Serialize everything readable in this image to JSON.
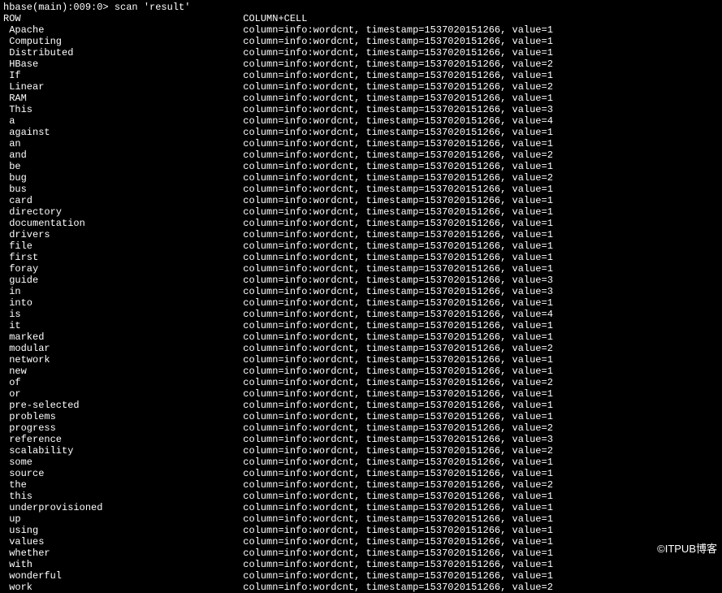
{
  "prompt": "hbase(main):009:0> scan 'result'",
  "header": {
    "row": "ROW",
    "columncell": "COLUMN+CELL"
  },
  "column_prefix": "column=info:wordcnt,",
  "timestamp_prefix": "timestamp=1537020151266,",
  "value_prefix": "value=",
  "rows": [
    {
      "key": "Apache",
      "value": 1
    },
    {
      "key": "Computing",
      "value": 1
    },
    {
      "key": "Distributed",
      "value": 1
    },
    {
      "key": "HBase",
      "value": 2
    },
    {
      "key": "If",
      "value": 1
    },
    {
      "key": "Linear",
      "value": 2
    },
    {
      "key": "RAM",
      "value": 1
    },
    {
      "key": "This",
      "value": 3
    },
    {
      "key": "a",
      "value": 4
    },
    {
      "key": "against",
      "value": 1
    },
    {
      "key": "an",
      "value": 1
    },
    {
      "key": "and",
      "value": 2
    },
    {
      "key": "be",
      "value": 1
    },
    {
      "key": "bug",
      "value": 2
    },
    {
      "key": "bus",
      "value": 1
    },
    {
      "key": "card",
      "value": 1
    },
    {
      "key": "directory",
      "value": 1
    },
    {
      "key": "documentation",
      "value": 1
    },
    {
      "key": "drivers",
      "value": 1
    },
    {
      "key": "file",
      "value": 1
    },
    {
      "key": "first",
      "value": 1
    },
    {
      "key": "foray",
      "value": 1
    },
    {
      "key": "guide",
      "value": 3
    },
    {
      "key": "in",
      "value": 3
    },
    {
      "key": "into",
      "value": 1
    },
    {
      "key": "is",
      "value": 4
    },
    {
      "key": "it",
      "value": 1
    },
    {
      "key": "marked",
      "value": 1
    },
    {
      "key": "modular",
      "value": 2
    },
    {
      "key": "network",
      "value": 1
    },
    {
      "key": "new",
      "value": 1
    },
    {
      "key": "of",
      "value": 2
    },
    {
      "key": "or",
      "value": 1
    },
    {
      "key": "pre-selected",
      "value": 1
    },
    {
      "key": "problems",
      "value": 1
    },
    {
      "key": "progress",
      "value": 2
    },
    {
      "key": "reference",
      "value": 3
    },
    {
      "key": "scalability",
      "value": 2
    },
    {
      "key": "some",
      "value": 1
    },
    {
      "key": "source",
      "value": 1
    },
    {
      "key": "the",
      "value": 2
    },
    {
      "key": "this",
      "value": 1
    },
    {
      "key": "underprovisioned",
      "value": 1
    },
    {
      "key": "up",
      "value": 1
    },
    {
      "key": "using",
      "value": 1
    },
    {
      "key": "values",
      "value": 1
    },
    {
      "key": "whether",
      "value": 1
    },
    {
      "key": "with",
      "value": 1
    },
    {
      "key": "wonderful",
      "value": 1
    },
    {
      "key": "work",
      "value": 2
    }
  ],
  "watermark": "©ITPUB博客"
}
